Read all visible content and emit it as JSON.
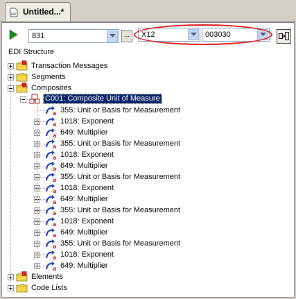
{
  "tab": {
    "title": "Untitled...*"
  },
  "toolbar": {
    "message_value": "831",
    "standard_value": "X12",
    "version_value": "003030",
    "browse_label": "..."
  },
  "tree": {
    "heading": "EDI Structure",
    "top_nodes": [
      {
        "label": "Transaction Messages"
      },
      {
        "label": "Segments"
      },
      {
        "label": "Composites"
      }
    ],
    "composite": {
      "label": "C001: Composite Unit of Measure"
    },
    "children": [
      {
        "label": "355: Unit or Basis for Measurement"
      },
      {
        "label": "1018: Exponent"
      },
      {
        "label": "649: Multiplier"
      },
      {
        "label": "355: Unit or Basis for Measurement"
      },
      {
        "label": "1018: Exponent"
      },
      {
        "label": "649: Multiplier"
      },
      {
        "label": "355: Unit or Basis for Measurement"
      },
      {
        "label": "1018: Exponent"
      },
      {
        "label": "649: Multiplier"
      },
      {
        "label": "355: Unit or Basis for Measurement"
      },
      {
        "label": "1018: Exponent"
      },
      {
        "label": "649: Multiplier"
      },
      {
        "label": "355: Unit or Basis for Measurement"
      },
      {
        "label": "1018: Exponent"
      },
      {
        "label": "649: Multiplier"
      }
    ],
    "bottom_nodes": [
      {
        "label": "Elements"
      },
      {
        "label": "Code Lists"
      }
    ]
  },
  "colors": {
    "selection": "#0a246a",
    "highlight_ellipse": "#d81818",
    "run_arrow": "#1e8a1e"
  }
}
